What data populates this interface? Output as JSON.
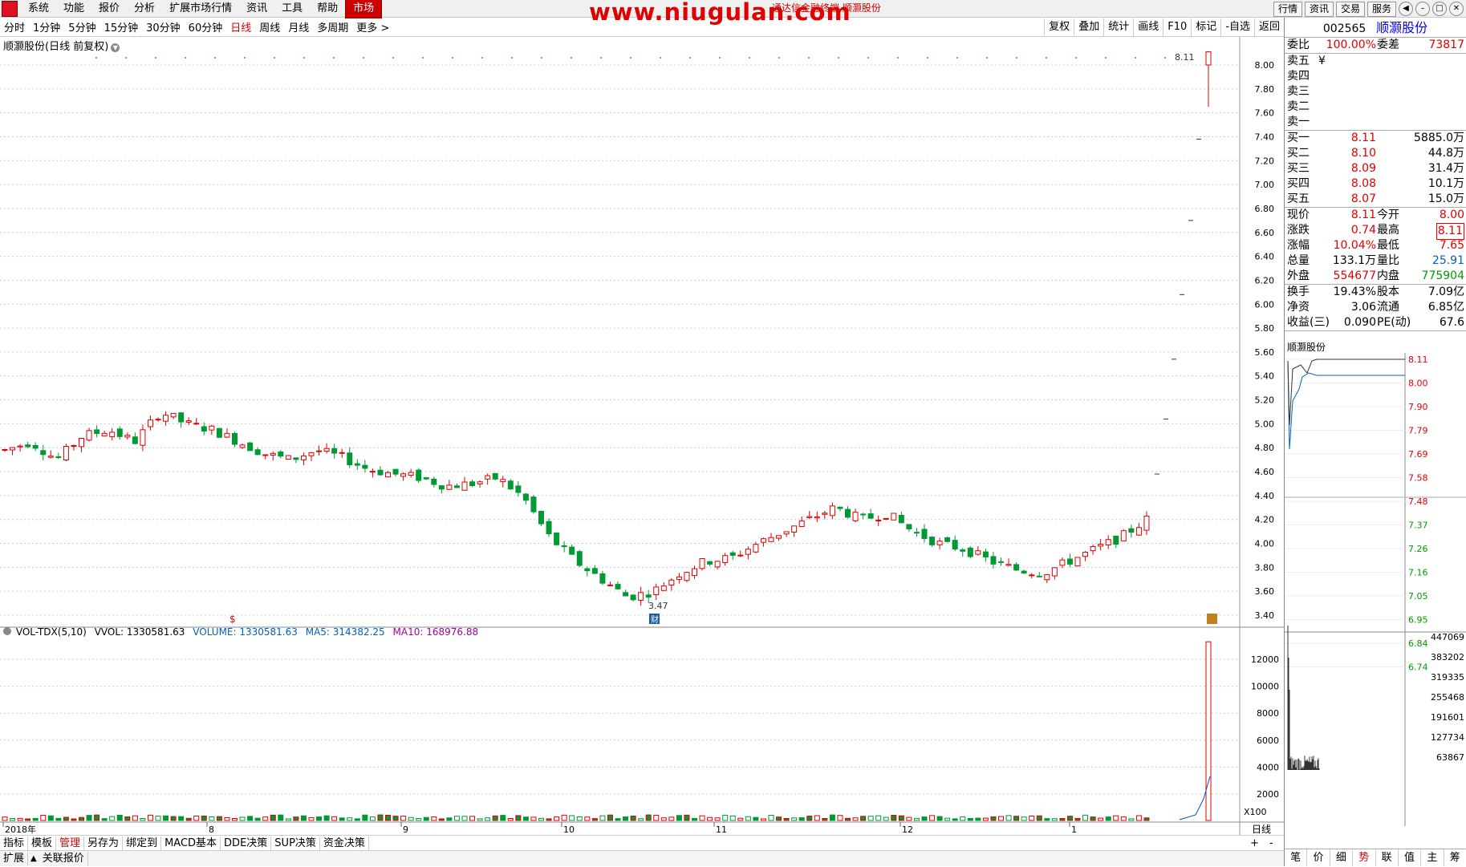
{
  "menubar": {
    "items": [
      "系统",
      "功能",
      "报价",
      "分析",
      "扩展市场行情",
      "资讯",
      "工具",
      "帮助"
    ],
    "active_item": "市场",
    "watermark": "www.niugulan.com",
    "watermark_sub": "通达信金融终端 顺灏股份",
    "right_buttons": [
      "行情",
      "资讯",
      "交易",
      "服务"
    ]
  },
  "periodbar": {
    "items": [
      "分时",
      "1分钟",
      "5分钟",
      "15分钟",
      "30分钟",
      "60分钟",
      "日线",
      "周线",
      "月线",
      "多周期",
      "更多"
    ],
    "active": "日线",
    "tools": [
      "复权",
      "叠加",
      "统计",
      "画线",
      "F10",
      "标记",
      "-自选",
      "返回"
    ]
  },
  "chart": {
    "title": "顺灏股份(日线 前复权)",
    "high_marker": "8.11",
    "low_marker": "3.47",
    "fin_marker": "财",
    "price_ticks": [
      "8.00",
      "7.80",
      "7.60",
      "7.40",
      "7.20",
      "7.00",
      "6.80",
      "6.60",
      "6.40",
      "6.20",
      "6.00",
      "5.80",
      "5.60",
      "5.40",
      "5.20",
      "5.00",
      "4.80",
      "4.60",
      "4.40",
      "4.20",
      "4.00",
      "3.80",
      "3.60",
      "3.40"
    ],
    "volume_header": {
      "name": "VOL-TDX(5,10)",
      "vvol": "VVOL: 1330581.63",
      "volume": "VOLUME: 1330581.63",
      "ma5": "MA5: 314382.25",
      "ma10": "MA10: 168976.88"
    },
    "volume_ticks": [
      "12000",
      "10000",
      "8000",
      "6000",
      "4000",
      "2000"
    ],
    "volume_unit": "X100",
    "date_labels": [
      "2018年",
      "8",
      "9",
      "10",
      "11",
      "12",
      "1"
    ],
    "period_label": "日线",
    "colors": {
      "up": "#e00000",
      "down": "#009933",
      "ma5": "#0050d0",
      "ma10": "#c000c0"
    }
  },
  "bottom_tabs": [
    "指标",
    "模板",
    "管理",
    "另存为",
    "绑定到",
    "MACD基本",
    "DDE决策",
    "SUP决策",
    "资金决策"
  ],
  "bottom_tabs_active": "管理",
  "bottom_tabs2": [
    "扩展",
    "关联报价"
  ],
  "bottom_plus": "+",
  "bottom_minus": "-",
  "quote": {
    "code": "002565",
    "name": "顺灏股份",
    "weibi_label": "委比",
    "weibi": "100.00%",
    "weicha_label": "委差",
    "weicha": "73817",
    "sells": [
      {
        "label": "卖五",
        "price": "¥",
        "vol": ""
      },
      {
        "label": "卖四",
        "price": "",
        "vol": ""
      },
      {
        "label": "卖三",
        "price": "",
        "vol": ""
      },
      {
        "label": "卖二",
        "price": "",
        "vol": ""
      },
      {
        "label": "卖一",
        "price": "",
        "vol": ""
      }
    ],
    "buys": [
      {
        "label": "买一",
        "price": "8.11",
        "vol": "5885.0万"
      },
      {
        "label": "买二",
        "price": "8.10",
        "vol": "44.8万"
      },
      {
        "label": "买三",
        "price": "8.09",
        "vol": "31.4万"
      },
      {
        "label": "买四",
        "price": "8.08",
        "vol": "10.1万"
      },
      {
        "label": "买五",
        "price": "8.07",
        "vol": "15.0万"
      }
    ],
    "stats": [
      {
        "l1": "现价",
        "v1": "8.11",
        "l2": "今开",
        "v2": "8.00"
      },
      {
        "l1": "涨跌",
        "v1": "0.74",
        "l2": "最高",
        "v2": "8.11"
      },
      {
        "l1": "涨幅",
        "v1": "10.04%",
        "l2": "最低",
        "v2": "7.65"
      },
      {
        "l1": "总量",
        "v1": "133.1万",
        "l2": "量比",
        "v2": "25.91"
      },
      {
        "l1": "外盘",
        "v1": "554677",
        "l2": "内盘",
        "v2": "775904"
      }
    ],
    "stats2": [
      {
        "l1": "换手",
        "v1": "19.43%",
        "l2": "股本",
        "v2": "7.09亿"
      },
      {
        "l1": "净资",
        "v1": "3.06",
        "l2": "流通",
        "v2": "6.85亿"
      },
      {
        "l1": "收益(三)",
        "v1": "0.090",
        "l2": "PE(动)",
        "v2": "67.6"
      }
    ],
    "mini_title": "顺灏股份",
    "mini_price_ticks": [
      "8.11",
      "8.00",
      "7.90",
      "7.79",
      "7.69",
      "7.58",
      "7.48",
      "7.37",
      "7.26",
      "7.16",
      "7.05",
      "6.95",
      "6.84",
      "6.74"
    ],
    "mini_vol_ticks": [
      "447069",
      "383202",
      "319335",
      "255468",
      "191601",
      "127734",
      "63867"
    ],
    "bottom_selector": [
      "笔",
      "价",
      "细",
      "势",
      "联",
      "值",
      "主",
      "筹"
    ],
    "bottom_selector_active": "势"
  }
}
